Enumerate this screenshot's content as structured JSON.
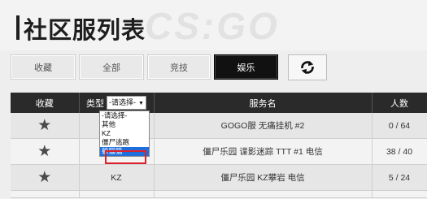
{
  "header": {
    "title": "社区服列表",
    "watermark": "CS:GO"
  },
  "filters": [
    {
      "label": "收藏",
      "active": false
    },
    {
      "label": "全部",
      "active": false
    },
    {
      "label": "竞技",
      "active": false
    },
    {
      "label": "娱乐",
      "active": true
    }
  ],
  "refresh": {
    "icon": "refresh-icon"
  },
  "table": {
    "columns": {
      "favorite": "收藏",
      "type": "类型",
      "name": "服务名",
      "players": "人数"
    },
    "type_select": {
      "selected": "-请选择-"
    },
    "rows": [
      {
        "type": "",
        "name": "GOGO服 无痛挂机 #2",
        "players": "0 / 64"
      },
      {
        "type": "",
        "name": "僵尸乐园 谍影迷踪 TTT #1 电信",
        "players": "38 / 40"
      },
      {
        "type": "KZ",
        "name": "僵尸乐园 KZ攀岩 电信",
        "players": "5 / 24"
      },
      {
        "type": "",
        "name": "",
        "players": ""
      }
    ]
  },
  "dropdown": {
    "options": [
      "-请选择-",
      "其他",
      "KZ",
      "僵尸逃跑",
      "躲猫猫"
    ],
    "selected_index": 4
  },
  "colors": {
    "header_bg": "#2a2a2a",
    "active_filter": "#111111",
    "dropdown_selected": "#1e6fdc",
    "highlight_box": "#e0202a"
  }
}
